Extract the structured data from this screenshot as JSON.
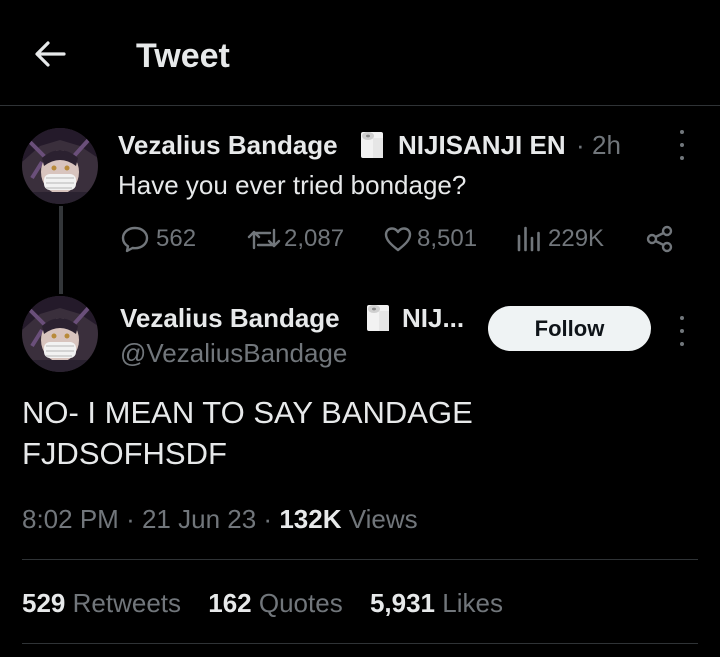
{
  "header": {
    "title": "Tweet"
  },
  "parent_tweet": {
    "author_name": "Vezalius Bandage",
    "affiliation": "NIJISANJI EN",
    "separator": "·",
    "time": "2h",
    "text": "Have you ever tried bondage?",
    "replies": "562",
    "retweets": "2,087",
    "likes": "8,501",
    "views": "229K"
  },
  "main_tweet": {
    "author_name": "Vezalius Bandage",
    "affiliation_truncated": "NIJ...",
    "handle": "@VezaliusBandage",
    "follow_label": "Follow",
    "text_lines": [
      "NO- I MEAN TO SAY BANDAGE",
      "FJDSOFHSDF"
    ],
    "time": "8:02 PM",
    "date": "21 Jun 23",
    "separator": "·",
    "views_count": "132K",
    "views_label": "Views"
  },
  "stats": {
    "retweets_count": "529",
    "retweets_label": "Retweets",
    "quotes_count": "162",
    "quotes_label": "Quotes",
    "likes_count": "5,931",
    "likes_label": "Likes"
  },
  "icons": {
    "back": "arrow-left-icon",
    "reply": "speech-bubble-icon",
    "retweet": "retweet-arrows-icon",
    "like": "heart-icon",
    "views": "bar-chart-icon",
    "share": "share-nodes-icon",
    "more": "vertical-ellipsis-icon",
    "affiliate_badge": "toilet-paper-roll-icon"
  },
  "colors": {
    "background": "#000000",
    "primary_text": "#e7e9ea",
    "secondary_text": "#71767b",
    "divider": "#2f3336",
    "follow_bg": "#eff3f4"
  }
}
